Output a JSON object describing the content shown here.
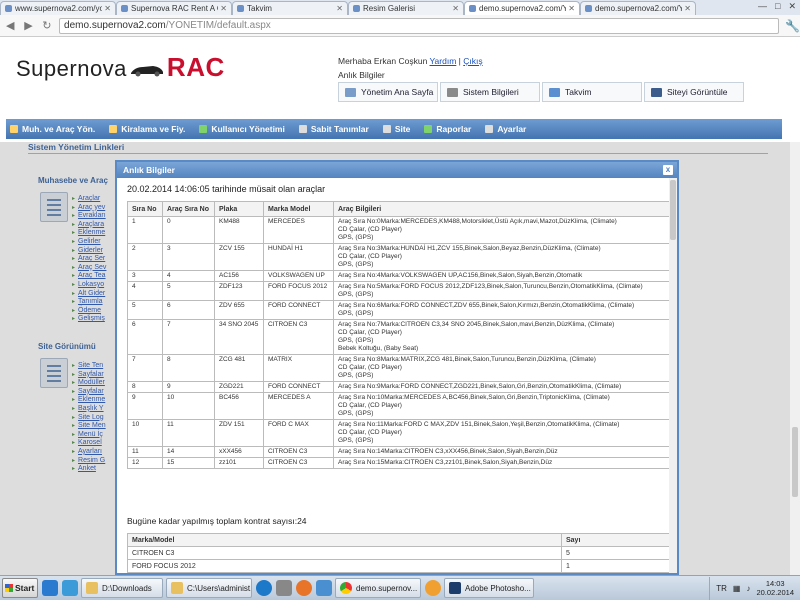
{
  "browser": {
    "tabs": [
      {
        "label": "www.supernova2.com/yon",
        "active": false
      },
      {
        "label": "Supernova RAC Rent A Car",
        "active": false
      },
      {
        "label": "Takvim",
        "active": false
      },
      {
        "label": "Resim Galerisi",
        "active": false
      },
      {
        "label": "demo.supernova2.com/YO",
        "active": true
      },
      {
        "label": "demo.supernova2.com/YO",
        "active": false
      }
    ],
    "url_host": "demo.supernova2.com",
    "url_path": "/YONETIM/default.aspx"
  },
  "header": {
    "logo_text": "Supernova",
    "logo_rac": "RAC",
    "greeting": "Merhaba Erkan Coşkun",
    "help_link": "Yardım",
    "separator": "|",
    "logout_link": "Çıkış",
    "anlik_label": "Anlık Bilgiler",
    "buttons": [
      {
        "label": "Yönetim Ana Sayfa",
        "icon": "home-icon"
      },
      {
        "label": "Sistem Bilgileri",
        "icon": "computer-icon"
      },
      {
        "label": "Takvim",
        "icon": "calendar-icon"
      },
      {
        "label": "Siteyi Görüntüle",
        "icon": "monitor-icon"
      }
    ]
  },
  "menu": [
    {
      "label": "Muh. ve Araç Yön."
    },
    {
      "label": "Kiralama ve Fiy."
    },
    {
      "label": "Kullanıcı Yönetimi"
    },
    {
      "label": "Sabit Tanımlar"
    },
    {
      "label": "Site"
    },
    {
      "label": "Raporlar"
    },
    {
      "label": "Ayarlar"
    }
  ],
  "page": {
    "heading": "Sistem Yönetim Linkleri",
    "section1_title": "Muhasebe ve Araç",
    "section1_links": [
      "Araçlar",
      "Araç yev",
      "Evrakları",
      "Araçlara",
      "Eklenme",
      "Gelirler",
      "Giderler",
      "Araç Ser",
      "Araç Sev",
      "Araç Tea",
      "Lokasyo",
      "Alt Gider",
      "Tanımla",
      "Ödeme",
      "Gelişmiş"
    ],
    "section2_title": "Site Görünümü",
    "section2_links": [
      "Site Ten",
      "Sayfalar",
      "Modüller",
      "Sayfalar",
      "Eklenme",
      "Başlık Y",
      "Site Log",
      "Site Men",
      "Menü İç",
      "Karosel",
      "Ayarları",
      "Resim G",
      "Anket"
    ]
  },
  "modal": {
    "title": "Anlık Bilgiler",
    "close_label": "x",
    "headline": "20.02.2014 14:06:05 tarihinde müsait olan araçlar",
    "columns": [
      "Sıra No",
      "Araç Sıra No",
      "Plaka",
      "Marka Model",
      "Araç Bilgileri"
    ],
    "rows": [
      {
        "sira": "1",
        "arac_sira": "0",
        "plaka": "KM488",
        "model": "MERCEDES",
        "info": [
          "Araç Sıra No:0Marka:MERCEDES,KM488,Motorsiklet,Üstü Açık,mavi,Mazot,DüzKlima, (Climate)",
          "CD Çalar, (CD Player)",
          "GPS, (GPS)"
        ]
      },
      {
        "sira": "2",
        "arac_sira": "3",
        "plaka": "ZCV 155",
        "model": "HUNDAİ H1",
        "info": [
          "Araç Sıra No:3Marka:HUNDAİ H1,ZCV 155,Binek,Salon,Beyaz,Benzin,DüzKlima, (Climate)",
          "CD Çalar, (CD Player)",
          "GPS, (GPS)"
        ]
      },
      {
        "sira": "3",
        "arac_sira": "4",
        "plaka": "AC156",
        "model": "VOLKSWAGEN UP",
        "info": [
          "Araç Sıra No:4Marka:VOLKSWAGEN UP,AC156,Binek,Salon,Siyah,Benzin,Otomatik"
        ]
      },
      {
        "sira": "4",
        "arac_sira": "5",
        "plaka": "ZDF123",
        "model": "FORD FOCUS 2012",
        "info": [
          "Araç Sıra No:5Marka:FORD FOCUS 2012,ZDF123,Binek,Salon,Turuncu,Benzin,OtomatikKlima, (Climate)",
          "GPS, (GPS)"
        ]
      },
      {
        "sira": "5",
        "arac_sira": "6",
        "plaka": "ZDV 655",
        "model": "FORD CONNECT",
        "info": [
          "Araç Sıra No:6Marka:FORD CONNECT,ZDV 655,Binek,Salon,Kırmızı,Benzin,OtomatikKlima, (Climate)",
          "GPS, (GPS)"
        ]
      },
      {
        "sira": "6",
        "arac_sira": "7",
        "plaka": "34 SNO 2045",
        "model": "CITROEN C3",
        "info": [
          "Araç Sıra No:7Marka:CITROEN C3,34 SNO 2045,Binek,Salon,mavi,Benzin,DüzKlima, (Climate)",
          "CD Çalar, (CD Player)",
          "GPS, (GPS)",
          "Bebek Koltuğu, (Baby Seat)"
        ]
      },
      {
        "sira": "7",
        "arac_sira": "8",
        "plaka": "ZCG 481",
        "model": "MATRIX",
        "info": [
          "Araç Sıra No:8Marka:MATRIX,ZCG 481,Binek,Salon,Turuncu,Benzin,DüzKlima, (Climate)",
          "CD Çalar, (CD Player)",
          "GPS, (GPS)"
        ]
      },
      {
        "sira": "8",
        "arac_sira": "9",
        "plaka": "ZGD221",
        "model": "FORD CONNECT",
        "info": [
          "Araç Sıra No:9Marka:FORD CONNECT,ZGD221,Binek,Salon,Gri,Benzin,OtomatikKlima, (Climate)"
        ]
      },
      {
        "sira": "9",
        "arac_sira": "10",
        "plaka": "BC456",
        "model": "MERCEDES A",
        "info": [
          "Araç Sıra No:10Marka:MERCEDES A,BC456,Binek,Salon,Gri,Benzin,TriptonicKlima, (Climate)",
          "CD Çalar, (CD Player)",
          "GPS, (GPS)"
        ]
      },
      {
        "sira": "10",
        "arac_sira": "11",
        "plaka": "ZDV 151",
        "model": "FORD C MAX",
        "info": [
          "Araç Sıra No:11Marka:FORD C MAX,ZDV 151,Binek,Salon,Yeşil,Benzin,OtomatikKlima, (Climate)",
          "CD Çalar, (CD Player)",
          "GPS, (GPS)"
        ]
      },
      {
        "sira": "11",
        "arac_sira": "14",
        "plaka": "xXX456",
        "model": "CITROEN C3",
        "info": [
          "Araç Sıra No:14Marka:CITROEN C3,xXX456,Binek,Salon,Siyah,Benzin,Düz"
        ]
      },
      {
        "sira": "12",
        "arac_sira": "15",
        "plaka": "zz101",
        "model": "CITROEN C3",
        "info": [
          "Araç Sıra No:15Marka:CITROEN C3,zz101,Binek,Salon,Siyah,Benzin,Düz"
        ]
      }
    ],
    "total_line": "Bugüne kadar yapılmış toplam kontrat sayısı:24",
    "contract_columns": [
      "Marka/Model",
      "Sayı"
    ],
    "contracts": [
      {
        "model": "CITROEN C3",
        "count": "5"
      },
      {
        "model": "FORD FOCUS 2012",
        "count": "1"
      }
    ]
  },
  "taskbar": {
    "start_label": "Start",
    "items": [
      {
        "label": "D:\\Downloads",
        "icon": "folder-icon"
      },
      {
        "label": "C:\\Users\\administ...",
        "icon": "folder-icon"
      },
      {
        "label": "demo.supernov...",
        "icon": "chrome-icon"
      },
      {
        "label": "Adobe Photosho...",
        "icon": "photoshop-icon"
      }
    ],
    "lang": "TR",
    "time": "14:03",
    "date": "20.02.2014"
  },
  "colors": {
    "accent": "#4474b1",
    "logo_red": "#c8102e",
    "link": "#1a4fbd"
  }
}
